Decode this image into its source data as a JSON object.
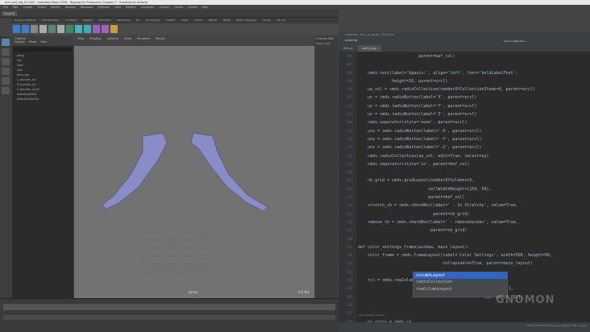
{
  "window": {
    "title": "arm_and_leg_01.mb* - Autodesk Maya 2018 - Rigging for Production Chapter 2 - Scripting an Autorig"
  },
  "menu": [
    "File",
    "Edit",
    "Create",
    "Select",
    "Modify",
    "Display",
    "Windows",
    "Skeleton",
    "Skin",
    "Deform",
    "Constrain",
    "Control",
    "Cache",
    "Arnold",
    "Help"
  ],
  "mode_dropdown": "Rigging",
  "shelf_tabs": [
    "Curves / Surfaces",
    "Poly Modeling",
    "Sculpting",
    "Rigging",
    "Animation",
    "Rendering",
    "FX",
    "FX Caching",
    "Custom",
    "XGen",
    "Arnold",
    "Bifrost",
    "MASH",
    "Motion Graphics",
    "Cache",
    "rob_rig"
  ],
  "shelf_colors": [
    "#3a7fd0",
    "#3a7fd0",
    "#888",
    "#aaa",
    "#5a8a6a",
    "#aaa",
    "#3a8a6a",
    "#4ab0c0",
    "#3ab0b0",
    "#a060c0",
    "#a060c0",
    "#c0a040"
  ],
  "outliner": {
    "title": "Outliner",
    "menu": [
      "Display",
      "Show",
      "Help"
    ],
    "items": [
      "persp",
      "top",
      "front",
      "side",
      "arms_grp",
      "L_shoulder_jnt",
      "R_shoulder_jnt",
      "L_shoulder_jnt_IK",
      "defaultLightSet",
      "defaultObjectSet"
    ]
  },
  "viewport": {
    "menu": [
      "View",
      "Shading",
      "Lighting",
      "Show",
      "Renderer",
      "Panels"
    ],
    "camera_label": "persp",
    "fps": "0.0 fps"
  },
  "channel_box": {
    "title": "Channel Box",
    "menu": [
      "Chann",
      "Edit"
    ]
  },
  "ide": {
    "project": "scripting",
    "file_title": "scripting - arm_ui_rig.py - PyCharm",
    "run_config": "Add Configuration...",
    "tabs": [
      "fkik.py",
      "arm_ui.py"
    ],
    "active_tab": 1,
    "line_start": 106,
    "lines": [
      "                         parent=baf_col)",
      "",
      "    cmds.text(label='Upaxis:', align='left', font='boldLabelFont',",
      "              height=16, parent=urcl)",
      "    ua_col = cmds.radioCollection(numberOfCollectionItems=6, parent=urcl)",
      "    ux = cmds.radioButton(label='X', parent=urcl)",
      "    uy = cmds.radioButton(label='Y', parent=urcl)",
      "    uz = cmds.radioButton(label='Z', parent=urcl)",
      "    cmds.separator(style='none', parent=urcl)",
      "    unx = cmds.radioButton(label='-X', parent=urcl)",
      "    uny = cmds.radioButton(label='-Y', parent=urcl)",
      "    unz = cmds.radioButton(label='-Z', parent=urcl)",
      "    cmds.radioCollection(ua_col, edit=True, select=uy)",
      "    cmds.separator(style='in', parent=baf_col)",
      "",
      "    cb_grid = cmds.gridLayout(numberOfColumns=2,",
      "                             cellWidthHeight=(250, 50),",
      "                             parent=baf_col)",
      "    stretch_cb = cmds.checkBox(label=' - Is Stretchy', value=True,",
      "                               parent=cb_grid)",
      "    remove_cb = cmds.checkBox(label=' - removeGuides', value=True,",
      "                              parent=cb_grid)",
      "",
      "def color_settings_frame(window, main_layout):",
      "    color_frame = cmds.frameLayout(label='Color Settings', width=500, height=90,",
      "                                   collapsable=True, parent=main_layout)",
      "",
      "    rcl = cmds.rowColumnLayout(numberOfColumns=2, height=60,",
      "                               columnWidth=[(1, 200), (2, 250)],",
      "                                                    (1, 'both', 5)],",
      "",
      "",
      "    pr_color = cmds.co"
    ],
    "autocomplete": [
      "columnLayout",
      "radioCollection",
      "rowColumnLayout"
    ],
    "breadcrumb": "color_settings_frame()",
    "status": "138:21  CRLF  UTF-8  4 spaces  Python 3  Git: master"
  },
  "watermark": "GNOMON WORKSHOP"
}
